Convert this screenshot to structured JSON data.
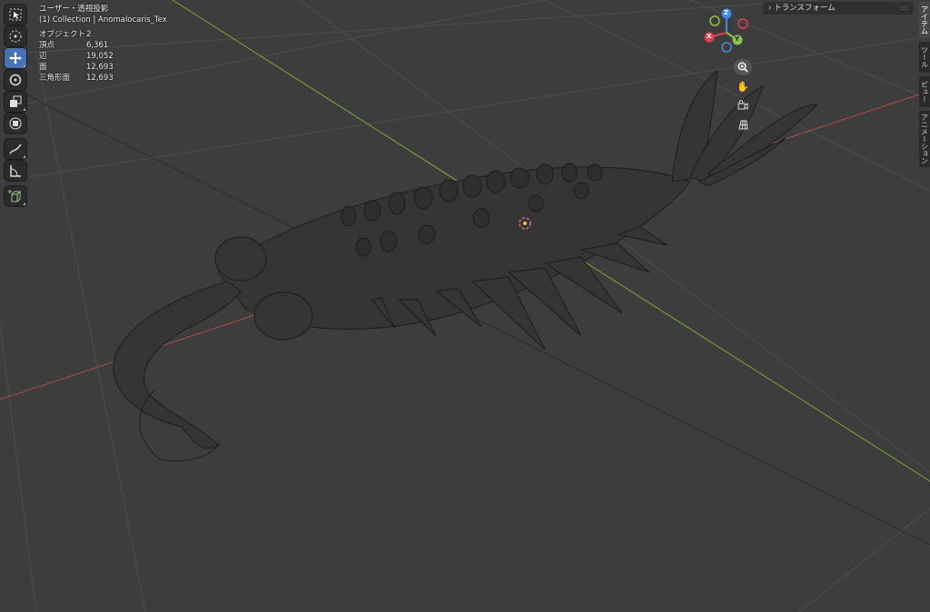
{
  "viewport": {
    "view_name": "ユーザー・透視投影",
    "collection": "(1) Collection | Anomalocaris_Tex",
    "stats": [
      {
        "label": "オブジェクト",
        "value": "2"
      },
      {
        "label": "頂点",
        "value": "6,361"
      },
      {
        "label": "辺",
        "value": "19,052"
      },
      {
        "label": "面",
        "value": "12,693"
      },
      {
        "label": "三角形面",
        "value": "12,693"
      }
    ]
  },
  "toolbar": {
    "tools": [
      {
        "name": "select-box",
        "icon": "select-box-icon",
        "active": false
      },
      {
        "name": "cursor",
        "icon": "cursor-icon",
        "active": false
      },
      {
        "name": "move",
        "icon": "move-icon",
        "active": true
      },
      {
        "name": "rotate",
        "icon": "rotate-icon",
        "active": false
      },
      {
        "name": "scale",
        "icon": "scale-icon",
        "active": false
      },
      {
        "name": "transform",
        "icon": "transform-icon",
        "active": false
      },
      {
        "name": "annotate",
        "icon": "annotate-icon",
        "active": false
      },
      {
        "name": "measure",
        "icon": "measure-icon",
        "active": false
      },
      {
        "name": "add-cube",
        "icon": "add-cube-icon",
        "active": false
      }
    ]
  },
  "gizmo": {
    "x_label": "X",
    "y_label": "Y",
    "z_label": "Z",
    "colors": {
      "x": "#e0404f",
      "y": "#8bc34a",
      "z": "#3c8ce6"
    }
  },
  "nav_buttons": [
    "zoom-icon",
    "pan-hand-icon",
    "camera-icon",
    "ortho-grid-icon"
  ],
  "sidebar": {
    "header_label": "トランスフォーム",
    "tabs": [
      {
        "label": "アイテム",
        "active": true
      },
      {
        "label": "ツール",
        "active": false
      },
      {
        "label": "ビュー",
        "active": false
      },
      {
        "label": "アニメーション",
        "active": false
      }
    ]
  },
  "colors": {
    "background": "#3d3d3d",
    "x_axis": "#b04a4a",
    "y_axis": "#7ba83a",
    "active_tool": "#4772b3"
  }
}
